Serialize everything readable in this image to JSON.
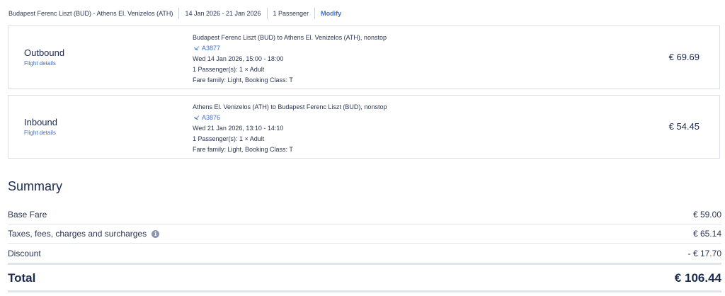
{
  "header": {
    "route": "Budapest Ferenc Liszt (BUD) - Athens El. Venizelos (ATH)",
    "dates": "14 Jan 2026 - 21 Jan 2026",
    "passengers": "1 Passenger",
    "modify_label": "Modify"
  },
  "outbound": {
    "title": "Outbound",
    "details_label": "Flight details",
    "route_line": "Budapest Ferenc Liszt (BUD) to Athens El. Venizelos (ATH), nonstop",
    "flight_number": "A3877",
    "datetime": "Wed 14 Jan 2026, 15:00 - 18:00",
    "passengers": "1 Passenger(s): 1 × Adult",
    "fare": "Fare family: Light, Booking Class: T",
    "price": "€ 69.69"
  },
  "inbound": {
    "title": "Inbound",
    "details_label": "Flight details",
    "route_line": "Athens El. Venizelos (ATH) to Budapest Ferenc Liszt (BUD), nonstop",
    "flight_number": "A3876",
    "datetime": "Wed 21 Jan 2026, 13:10 - 14:10",
    "passengers": "1 Passenger(s): 1 × Adult",
    "fare": "Fare family: Light, Booking Class: T",
    "price": "€ 54.45"
  },
  "summary": {
    "title": "Summary",
    "base_fare_label": "Base Fare",
    "base_fare_value": "€ 59.00",
    "taxes_label": "Taxes, fees, charges and surcharges",
    "taxes_value": "€ 65.14",
    "discount_label": "Discount",
    "discount_value": "- € 17.70",
    "total_label": "Total",
    "total_value": "€ 106.44"
  },
  "icons": {
    "plane": "plane-icon",
    "info": "info-icon"
  },
  "colors": {
    "accent": "#3b6fc4",
    "text": "#1b2a4e"
  }
}
